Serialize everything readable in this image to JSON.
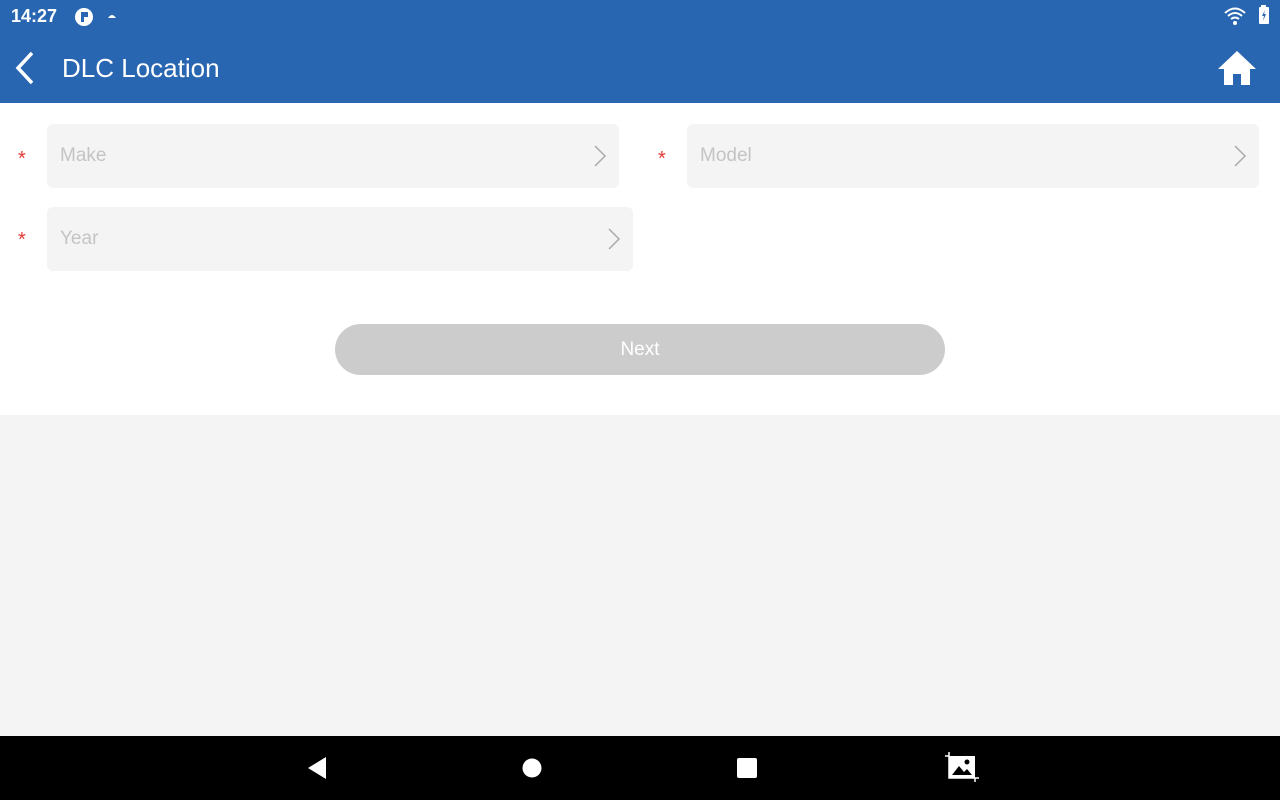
{
  "status_bar": {
    "time": "14:27",
    "icons": [
      "app-notification-icon",
      "weather-icon",
      "wifi-icon",
      "battery-charging-icon"
    ]
  },
  "header": {
    "title": "DLC Location",
    "back_icon": "chevron-left-icon",
    "home_icon": "home-icon"
  },
  "form": {
    "required_marker": "*",
    "fields": [
      {
        "placeholder": "Make"
      },
      {
        "placeholder": "Model"
      },
      {
        "placeholder": "Year"
      }
    ],
    "next_label": "Next"
  },
  "colors": {
    "primary": "#2966b1",
    "required": "#e53935",
    "button_disabled": "#cccccc"
  },
  "nav_bar": {
    "icons": [
      "back-triangle-icon",
      "home-circle-icon",
      "recents-square-icon",
      "screenshot-icon"
    ]
  }
}
